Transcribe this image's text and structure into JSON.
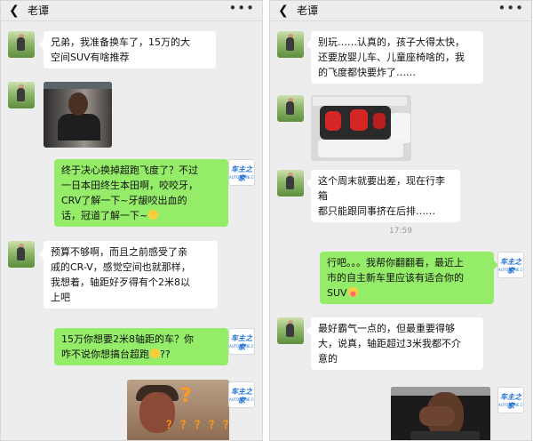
{
  "chat": {
    "contact_name": "老谭",
    "time_divider": "17:59",
    "brand_logo": "车主之家",
    "brand_logo_sub": "AUTOHOME.COM.CN"
  },
  "icons": {
    "back": "back-chevron-icon",
    "more": "more-dots-icon"
  },
  "left_panel": {
    "messages": [
      {
        "from": "friend",
        "type": "text",
        "text": "兄弟，我准备换车了，15万的大\n空间SUV有啥推荐"
      },
      {
        "from": "friend",
        "type": "image",
        "image": "boy-photo"
      },
      {
        "from": "me",
        "type": "text",
        "text": "终于决心换掉超跑飞度了？不过\n一日本田终生本田啊，咬咬牙，\nCRV了解一下~牙龈咬出血的\n话，冠道了解一下~"
      },
      {
        "from": "friend",
        "type": "text",
        "text": "预算不够啊，而且之前感受了亲\n戚的CR-V，感觉空间也就那样，\n我想着，轴距好歹得有个2米8以\n上吧"
      },
      {
        "from": "me",
        "type": "text",
        "text": "15万你想要2米8轴距的车？你\n咋不说你想搞台超跑"
      },
      {
        "from": "me",
        "type": "image",
        "image": "old-woman-question-marks",
        "overlay": "？？？？？"
      }
    ]
  },
  "right_panel": {
    "messages": [
      {
        "from": "friend",
        "type": "text",
        "text": "别玩……认真的，孩子大得太快，\n还要放婴儿车、儿童座椅啥的，我\n的飞度都快要炸了……"
      },
      {
        "from": "friend",
        "type": "image",
        "image": "trunk-with-child-seats"
      },
      {
        "from": "friend",
        "type": "text",
        "text": "这个周末就要出差，现在行李箱\n都只能跟同事挤在后排……"
      },
      {
        "from": "me",
        "type": "text",
        "text": "行吧。。。我帮你翻翻看，最近上\n市的自主新车里应该有适合你的\nSUV"
      },
      {
        "from": "friend",
        "type": "text",
        "text": "最好霸气一点的，但最重要得够\n大，说真，轴距超过3米我都不介\n意的"
      },
      {
        "from": "me",
        "type": "image",
        "image": "facepalm-man"
      }
    ]
  },
  "colors": {
    "chat_bg": "#ededed",
    "bubble_in": "#ffffff",
    "bubble_out": "#95ec69",
    "text": "#111111",
    "timestamp": "#9a9a9a",
    "brand_blue": "#1d6fd6"
  }
}
